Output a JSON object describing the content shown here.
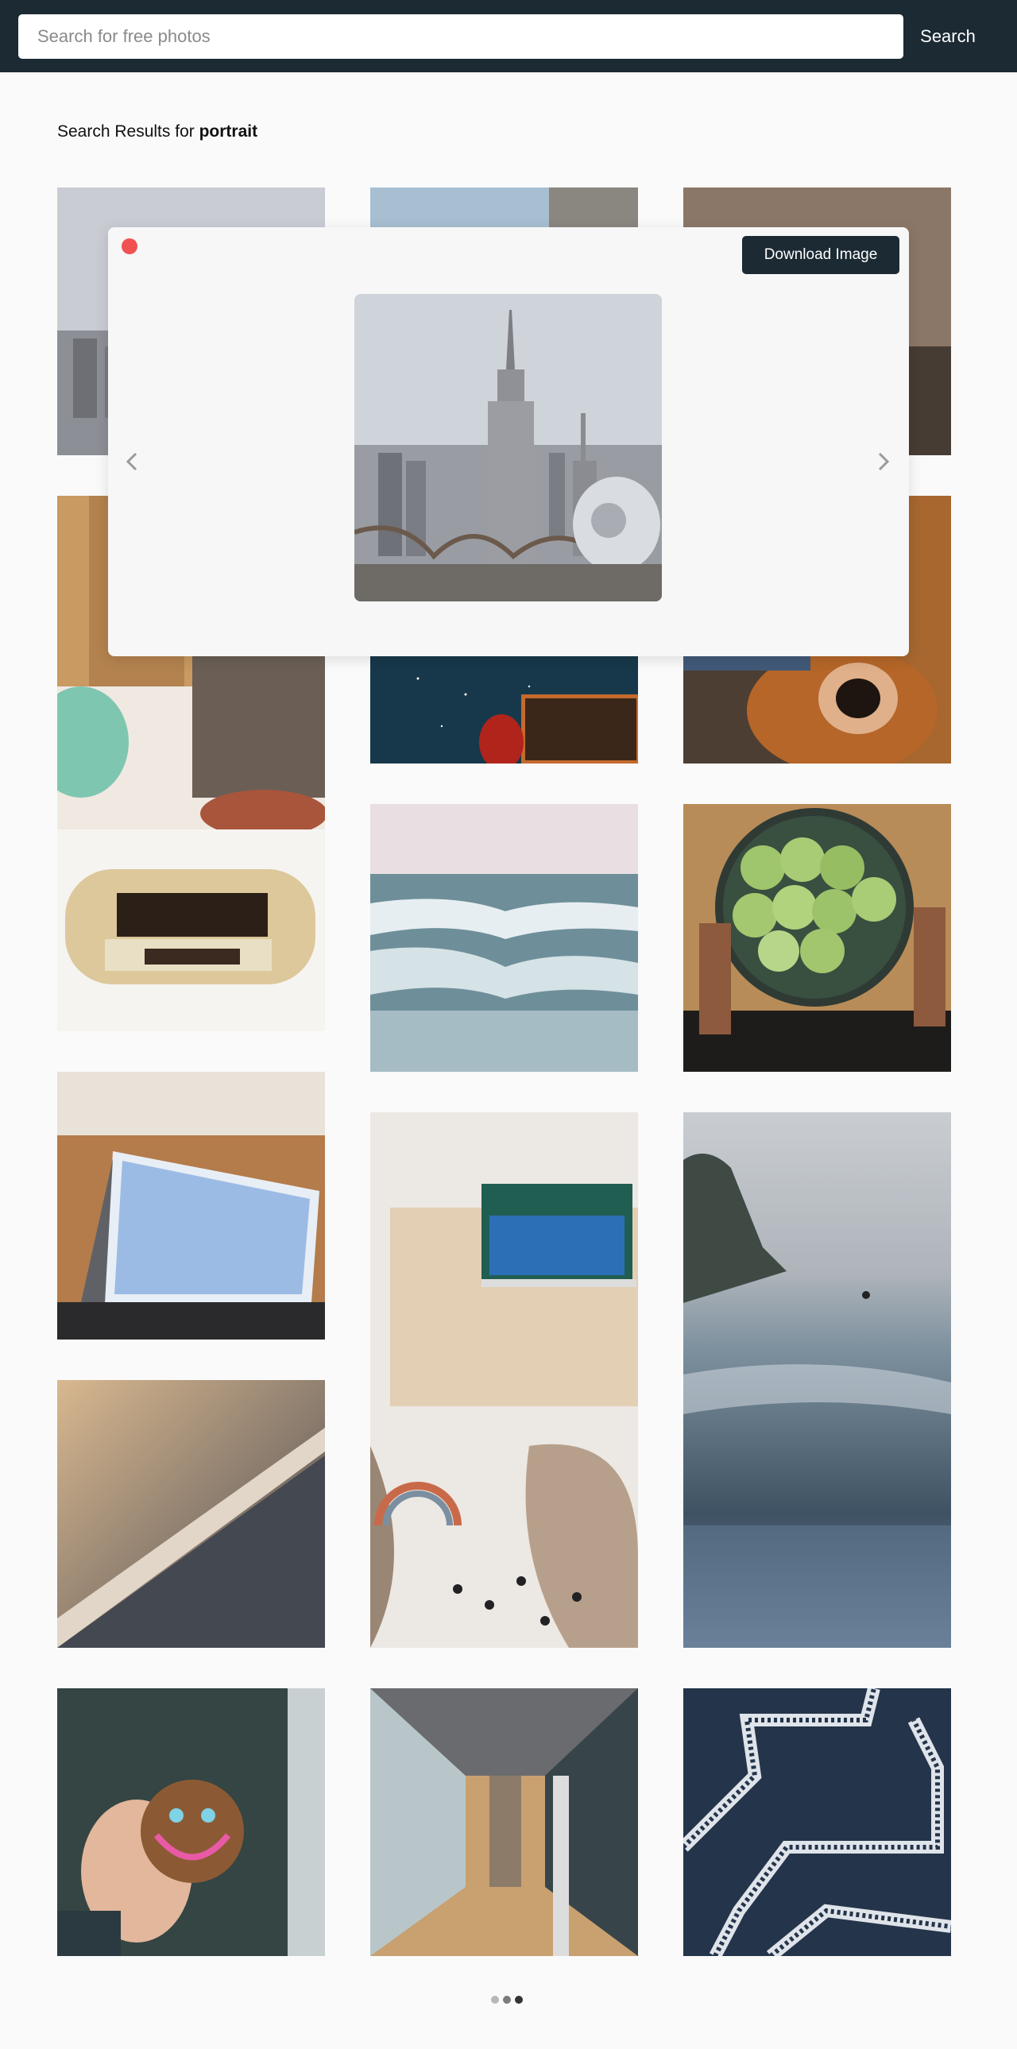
{
  "search": {
    "placeholder": "Search for free photos",
    "button_label": "Search"
  },
  "results": {
    "prefix": "Search Results for ",
    "query": "portrait"
  },
  "modal": {
    "download_label": "Download Image"
  },
  "pagination": {
    "count": 3,
    "active_index": 2
  }
}
